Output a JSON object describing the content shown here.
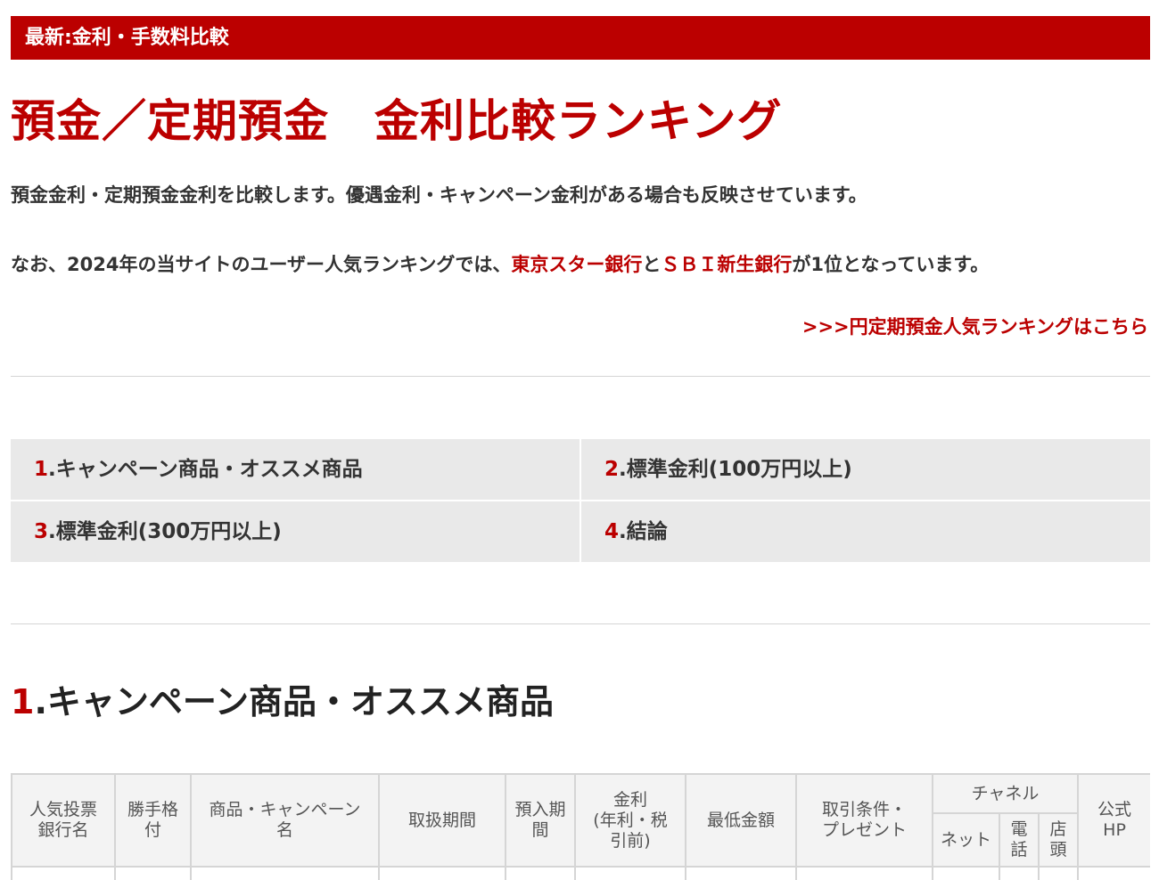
{
  "header": {
    "label": "最新:金利・手数料比較"
  },
  "page": {
    "title": "預金／定期預金　金利比較ランキング",
    "intro1": "預金金利・定期預金金利を比較します。優遇金利・キャンペーン金利がある場合も反映させています。",
    "intro2_prefix": "なお、2024年の当サイトのユーザー人気ランキングでは、",
    "intro2_link1": "東京スター銀行",
    "intro2_mid": "と",
    "intro2_link2": "ＳＢＩ新生銀行",
    "intro2_suffix": "が1位となっています。",
    "more_link": ">>>円定期預金人気ランキングはこちら"
  },
  "toc": [
    {
      "num": "1",
      "label": ".キャンペーン商品・オススメ商品"
    },
    {
      "num": "2",
      "label": ".標準金利(100万円以上)"
    },
    {
      "num": "3",
      "label": ".標準金利(300万円以上)"
    },
    {
      "num": "4",
      "label": ".結論"
    }
  ],
  "section1": {
    "num": "1",
    "title": ".キャンペーン商品・オススメ商品"
  },
  "table": {
    "headers": {
      "bank": "人気投票\n銀行名",
      "rating": "勝手格\n付",
      "product": "商品・キャンペーン\n名",
      "period": "取扱期間",
      "term": "預入期\n間",
      "rate": "金利\n(年利・税\n引前)",
      "min": "最低金額",
      "conditions": "取引条件・\nプレゼント",
      "channel": "チャネル",
      "net": "ネット",
      "phone": "電\n話",
      "branch": "店\n頭",
      "hp": "公式\nHP"
    }
  }
}
